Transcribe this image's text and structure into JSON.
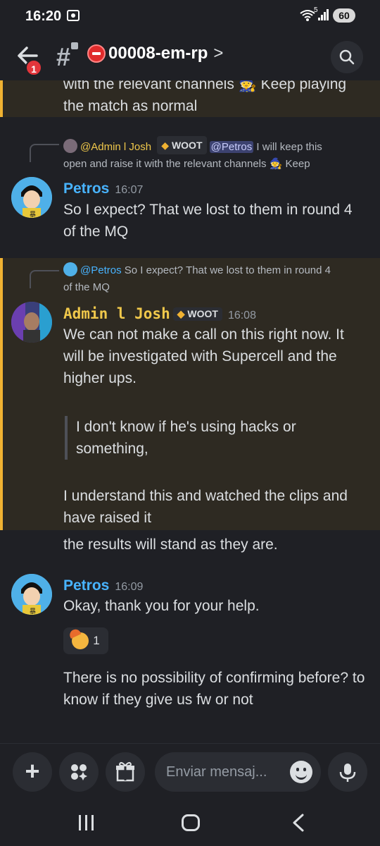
{
  "status_bar": {
    "time": "16:20",
    "battery": "60",
    "wifi_label": "5"
  },
  "header": {
    "badge_count": "1",
    "channel_name": "00008-em-rp",
    "chevron": ">"
  },
  "messages": [
    {
      "type": "continuation",
      "text_line1": "with the relevant channels 🧙 Keep playing",
      "text_line2": "the match as normal"
    },
    {
      "type": "reply",
      "reply": {
        "author": "@Admin l Josh",
        "role": "WOOT",
        "mention": "@Petros",
        "text_after_mention": " I will keep this",
        "text_line2": "open and raise it with the relevant channels 🧙 Keep"
      },
      "author": "Petros",
      "time": "16:07",
      "text": "So I expect? That we lost to them in round 4 of the MQ"
    },
    {
      "type": "reply",
      "reply": {
        "author": "@Petros",
        "text": " So I expect? That we lost to them in round 4",
        "text_line2": "of the MQ"
      },
      "author": "Admin l Josh",
      "role": "WOOT",
      "time": "16:08",
      "text": "We can not make a call on this right now. It will be investigated with Supercell and the higher ups.",
      "quote": "I don't know if he's using hacks or something,",
      "text_after_quote": "I understand this and watched the clips and have raised it",
      "text_followup": "the results will stand as they are."
    },
    {
      "type": "message",
      "author": "Petros",
      "time": "16:09",
      "text": "Okay, thank you for your help.",
      "reaction_count": "1",
      "text_followup": "There is no possibility of confirming before? to know if they give us fw or not"
    }
  ],
  "composer": {
    "placeholder": "Enviar mensaj..."
  },
  "colors": {
    "background": "#1f2025",
    "highlight_border": "#f0b232",
    "petros_name": "#48b3ff",
    "admin_name": "#f0c84b",
    "mention_bg": "#3c4270"
  },
  "icons": [
    "back-arrow-icon",
    "hash-icon",
    "search-icon",
    "plus-icon",
    "apps-icon",
    "gift-icon",
    "emoji-icon",
    "microphone-icon"
  ]
}
